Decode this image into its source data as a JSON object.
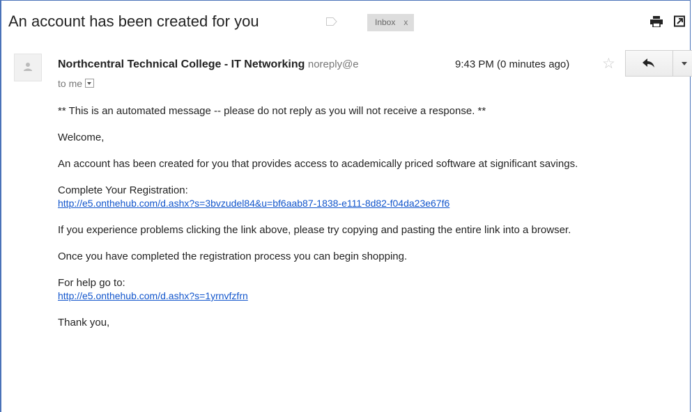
{
  "email": {
    "subject": "An account has been created for you",
    "label_chip": "Inbox",
    "label_chip_close": "x",
    "sender_name": "Northcentral Technical College - IT Networking",
    "sender_email": "noreply@e",
    "recipient": "to me",
    "time": "9:43 PM (0 minutes ago)",
    "body": {
      "notice": "** This is an automated message -- please do not reply as you will not receive a response. **",
      "greeting": "Welcome,",
      "intro": "An account has been created for you that provides access to academically priced software at significant savings.",
      "registration_label": "Complete Your Registration:",
      "registration_link": "http://e5.onthehub.com/d.ashx?s=3bvzudel84&u=bf6aab87-1838-e111-8d82-f04da23e67f6",
      "problems": "If you experience problems clicking the link above, please try copying and pasting the entire link into a browser.",
      "shopping": "Once you have completed the registration process you can begin shopping.",
      "help_label": "For help go to:",
      "help_link": "http://e5.onthehub.com/d.ashx?s=1yrnvfzfrn",
      "closing": "Thank you,"
    }
  },
  "icons": {
    "label": "label-tag-icon",
    "print": "print-icon",
    "new_window": "new-window-icon",
    "avatar": "avatar-icon",
    "star": "star-icon",
    "reply": "reply-icon",
    "more": "chevron-down-icon"
  },
  "colors": {
    "frame_border": "#4a72b8",
    "link": "#1155cc",
    "chip_bg": "#dddddd"
  }
}
